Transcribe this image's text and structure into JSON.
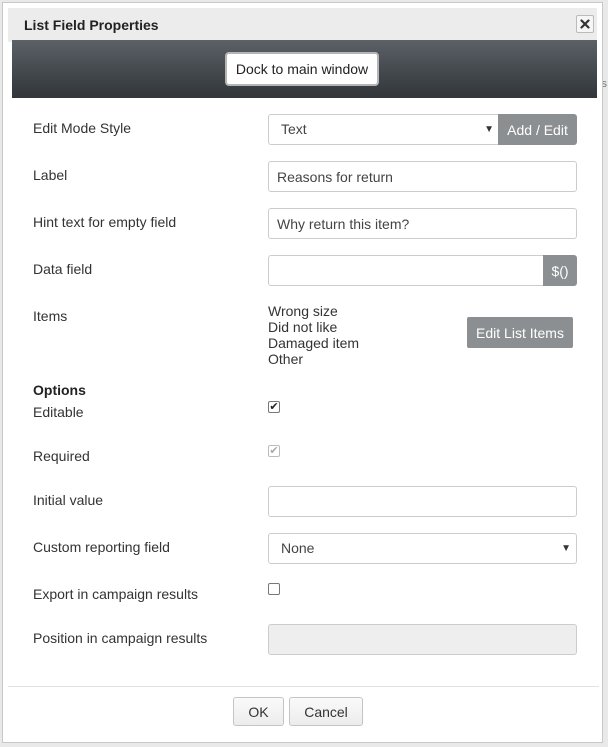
{
  "background": {
    "peek_text": "s"
  },
  "dialog": {
    "title": "List Field Properties",
    "dock_button": "Dock to main window"
  },
  "form": {
    "edit_mode_style": {
      "label": "Edit Mode Style",
      "value": "Text",
      "button": "Add / Edit"
    },
    "label": {
      "label": "Label",
      "value": "Reasons for return"
    },
    "hint": {
      "label": "Hint text for empty field",
      "value": "Why return this item?"
    },
    "data_field": {
      "label": "Data field",
      "value": "",
      "button": "$()"
    },
    "items": {
      "label": "Items",
      "values": [
        "Wrong size",
        "Did not like",
        "Damaged item",
        "Other"
      ],
      "button": "Edit List Items"
    }
  },
  "options": {
    "heading": "Options",
    "editable": {
      "label": "Editable",
      "checked": true
    },
    "required": {
      "label": "Required",
      "checked": true,
      "disabled": true
    },
    "initial_value": {
      "label": "Initial value",
      "value": ""
    },
    "custom_reporting": {
      "label": "Custom reporting field",
      "value": "None"
    },
    "export": {
      "label": "Export in campaign results",
      "checked": false
    },
    "position": {
      "label": "Position in campaign results",
      "value": ""
    }
  },
  "footer": {
    "ok": "OK",
    "cancel": "Cancel"
  }
}
